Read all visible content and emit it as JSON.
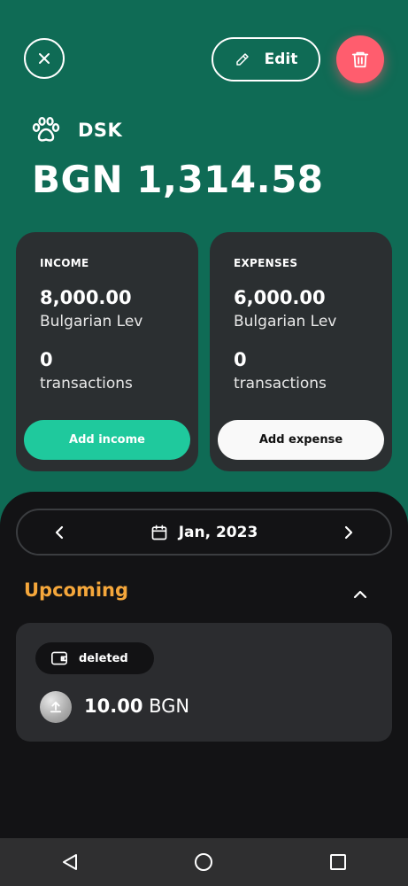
{
  "header": {
    "edit_label": "Edit"
  },
  "account": {
    "icon": "paw-icon",
    "name": "DSK",
    "balance": "BGN 1,314.58"
  },
  "income_card": {
    "title": "INCOME",
    "amount": "8,000.00",
    "currency": "Bulgarian Lev",
    "count": "0",
    "count_label": "transactions",
    "button_label": "Add income"
  },
  "expenses_card": {
    "title": "EXPENSES",
    "amount": "6,000.00",
    "currency": "Bulgarian Lev",
    "count": "0",
    "count_label": "transactions",
    "button_label": "Add expense"
  },
  "month_nav": {
    "label": "Jan, 2023"
  },
  "upcoming": {
    "title": "Upcoming",
    "items": [
      {
        "tag": "deleted",
        "amount": "10.00",
        "currency": "BGN"
      }
    ]
  },
  "colors": {
    "background": "#0f6b55",
    "card": "#2b2f31",
    "income_accent": "#1fc99d",
    "delete_accent": "#ff5d6e",
    "upcoming_accent": "#f5a73b",
    "sheet": "#131315"
  }
}
